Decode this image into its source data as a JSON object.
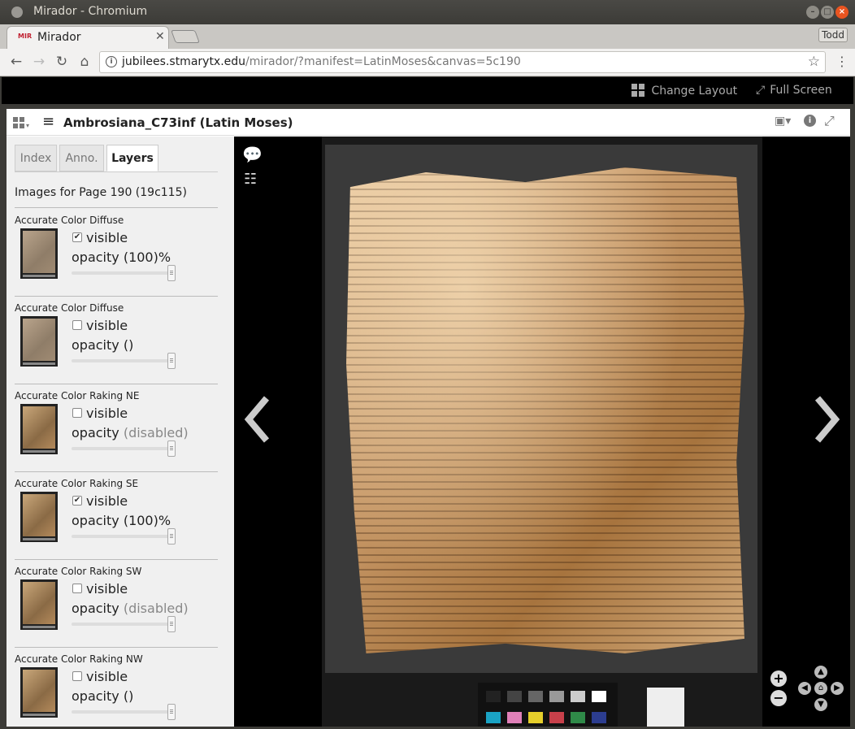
{
  "browser": {
    "window_title": "Mirador - Chromium",
    "tab_label": "Mirador",
    "favicon_text": "MIR",
    "user_button": "Todd",
    "url_host": "jubilees.stmarytx.edu",
    "url_rest": "/mirador/?manifest=LatinMoses&canvas=5c190"
  },
  "mirador": {
    "change_layout": "Change Layout",
    "full_screen": "Full Screen",
    "window_title": "Ambrosiana_C73inf (Latin Moses)"
  },
  "sidebar": {
    "tabs": [
      {
        "label": "Index",
        "active": false
      },
      {
        "label": "Anno.",
        "active": false
      },
      {
        "label": "Layers",
        "active": true
      }
    ],
    "page_heading": "Images for Page 190 (19c115)",
    "visible_label": "visible",
    "opacity_label": "opacity",
    "layers": [
      {
        "name": "Accurate Color Diffuse",
        "checked": true,
        "opacity": "(100)%",
        "disabled": false
      },
      {
        "name": "Accurate Color Diffuse",
        "checked": false,
        "opacity": "()",
        "disabled": false
      },
      {
        "name": "Accurate Color Raking NE",
        "checked": false,
        "opacity": "(disabled)",
        "disabled": true
      },
      {
        "name": "Accurate Color Raking SE",
        "checked": true,
        "opacity": "(100)%",
        "disabled": false
      },
      {
        "name": "Accurate Color Raking SW",
        "checked": false,
        "opacity": "(disabled)",
        "disabled": true
      },
      {
        "name": "Accurate Color Raking NW",
        "checked": false,
        "opacity": "()",
        "disabled": false
      }
    ]
  },
  "icons": {
    "annotations": "comments-icon",
    "tools": "sliders-icon",
    "prev": "chevron-left-icon",
    "next": "chevron-right-icon",
    "zoom_in": "plus-icon",
    "zoom_out": "minus-icon",
    "home": "home-icon"
  },
  "colors": {
    "accent_text": "#aaaaaa",
    "viewer_bg": "#000000",
    "sidebar_bg": "#f0f0f0"
  }
}
